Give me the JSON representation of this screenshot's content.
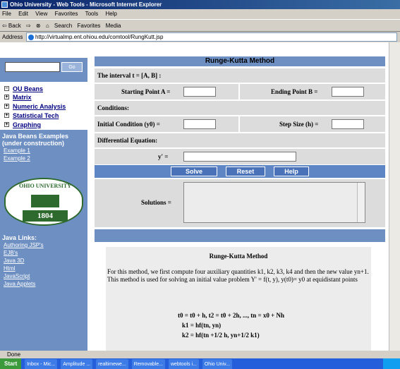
{
  "window": {
    "title": "Ohio University - Web Tools - Microsoft Internet Explorer"
  },
  "menu": [
    "File",
    "Edit",
    "View",
    "Favorites",
    "Tools",
    "Help"
  ],
  "toolbar": [
    "⇦ Back",
    "⇨",
    "⊗",
    "⌂",
    "Search",
    "Favorites",
    "Media"
  ],
  "address": {
    "label": "Address",
    "url": "http://virtualmp.ent.ohiou.edu/comtool/RungKutt.jsp"
  },
  "sidebar": {
    "go": "Go",
    "beans_head": "OU Beans",
    "beans": [
      "Matrix",
      "Numeric Analysis",
      "Statistical Tech",
      "Graphing"
    ],
    "java_beans_examples": "Java Beans Examples (under construction)",
    "examples": [
      "Example 1",
      "Example 2"
    ],
    "logo_text": "OHIO UNIVERSITY",
    "logo_year": "1804",
    "java_links_head": "Java Links:",
    "java_links": [
      "Authoring JSP's",
      "EJB's",
      "Java 3D",
      "Html",
      "JavaScript",
      "Java Applets"
    ]
  },
  "form": {
    "title": "Runge-Kutta Method",
    "interval": "The interval t = [A, B] :",
    "start_label": "Starting Point A =",
    "end_label": "Ending Point B =",
    "conditions": "Conditions:",
    "initial_label": "Initial Condition (y0) =",
    "step_label": "Step Size (h) =",
    "diffeq": "Differential Equation:",
    "yprime": "y' =",
    "solve": "Solve",
    "reset": "Reset",
    "help": "Help",
    "solutions": "Solutions ="
  },
  "doc": {
    "title": "Runge-Kutta Method",
    "para": "For this method, we first compute four auxiliary quantities k1, k2, k3, k4 and then the new value yn+1. This method is used for solving an initial value problem Y' = f(t, y), y(t0)= y0 at equidistant points",
    "eq1": "t0 = t0 + h, t2 = t0 + 2h, ..., tn = x0 + Nh",
    "eq2": "k1 = hf(tn, yn)",
    "eq3": "k2 = hf(tn +1/2 h,  yn+1/2 k1)"
  },
  "status": "Done",
  "taskbar": {
    "start": "Start",
    "tasks": [
      "Inbox - Mic...",
      "Amplitude ...",
      "realtimewe...",
      "Removable...",
      "webtools i...",
      "Ohio Univ..."
    ]
  }
}
